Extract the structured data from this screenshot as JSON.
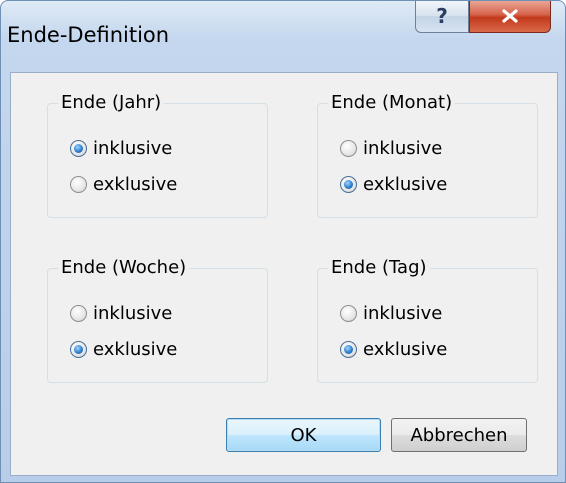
{
  "window": {
    "title": "Ende-Definition",
    "help_label": "?",
    "help_icon": "question-mark",
    "close_icon": "x-close"
  },
  "groups": [
    {
      "label": "Ende (Jahr)",
      "options": [
        {
          "label": "inklusive",
          "selected": true
        },
        {
          "label": "exklusive",
          "selected": false
        }
      ]
    },
    {
      "label": "Ende (Monat)",
      "options": [
        {
          "label": "inklusive",
          "selected": false
        },
        {
          "label": "exklusive",
          "selected": true
        }
      ]
    },
    {
      "label": "Ende (Woche)",
      "options": [
        {
          "label": "inklusive",
          "selected": false
        },
        {
          "label": "exklusive",
          "selected": true
        }
      ]
    },
    {
      "label": "Ende (Tag)",
      "options": [
        {
          "label": "inklusive",
          "selected": false
        },
        {
          "label": "exklusive",
          "selected": true
        }
      ]
    }
  ],
  "buttons": {
    "ok": "OK",
    "cancel": "Abbrechen"
  },
  "colors": {
    "close_button": "#c8452a",
    "default_button_border": "#3c7fb1",
    "radio_selected": "#2f7fd0"
  }
}
